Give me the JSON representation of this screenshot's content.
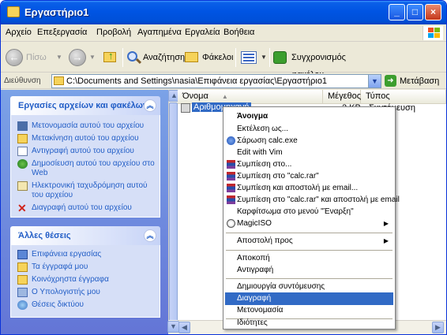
{
  "window": {
    "title": "Εργαστήριο1",
    "controls": {
      "minimize": "_",
      "maximize": "□",
      "close": "×"
    }
  },
  "menubar": {
    "items": [
      "Αρχείο",
      "Επεξεργασία",
      "Προβολή",
      "Αγαπημένα",
      "Εργαλεία",
      "Βοήθεια"
    ]
  },
  "toolbar": {
    "back": "Πίσω",
    "search": "Αναζήτηση",
    "folders": "Φάκελοι",
    "sync": "Συγχρονισμός φακέλου"
  },
  "address": {
    "label": "Διεύθυνση",
    "path": "C:\\Documents and Settings\\nasia\\Επιφάνεια εργασίας\\Εργαστήριο1",
    "go": "Μετάβαση"
  },
  "left_pane": {
    "file_tasks": {
      "title": "Εργασίες αρχείων και φακέλων",
      "items": [
        "Μετονομασία αυτού του αρχείου",
        "Μετακίνηση αυτού του αρχείου",
        "Αντιγραφή αυτού του αρχείου",
        "Δημοσίευση αυτού του αρχείου στο Web",
        "Ηλεκτρονική ταχυδρόμηση αυτού του αρχείου",
        "Διαγραφή αυτού του αρχείου"
      ]
    },
    "other_places": {
      "title": "Άλλες θέσεις",
      "items": [
        "Επιφάνεια εργασίας",
        "Τα έγγραφά μου",
        "Κοινόχρηστα έγγραφα",
        "Ο Υπολογιστής μου",
        "Θέσεις δικτύου"
      ]
    }
  },
  "file_list": {
    "columns": [
      "Όνομα",
      "Μέγεθος",
      "Τύπος"
    ],
    "rows": [
      {
        "name": "Αριθμομηχανή",
        "size": "2 KB",
        "type": "Συντόμευση"
      }
    ]
  },
  "context_menu": {
    "items": [
      {
        "label": "Άνοιγμα",
        "bold": true
      },
      {
        "label": "Εκτέλεση ως..."
      },
      {
        "label": "Σάρωση calc.exe"
      },
      {
        "label": "Edit with Vim"
      },
      {
        "label": "Συμπίεση στο..."
      },
      {
        "label": "Συμπίεση στο \"calc.rar\""
      },
      {
        "label": "Συμπίεση και αποστολή με email..."
      },
      {
        "label": "Συμπίεση στο \"calc.rar\" και αποστολή με email"
      },
      {
        "label": "Καρφίτσωμα στο μενού \"Έναρξη\""
      },
      {
        "label": "MagicISO",
        "submenu": true
      },
      {
        "label": "Αποστολή προς",
        "submenu": true
      },
      {
        "label": "Αποκοπή"
      },
      {
        "label": "Αντιγραφή"
      },
      {
        "label": "Δημιουργία συντόμευσης"
      },
      {
        "label": "Διαγραφή",
        "highlighted": true
      },
      {
        "label": "Μετονομασία"
      },
      {
        "label": "Ιδιότητες"
      }
    ]
  },
  "colors": {
    "titlebar": "#0054e3",
    "task_link": "#215dc6",
    "highlight": "#316ac5",
    "left_pane_bg": "#6375d6"
  }
}
